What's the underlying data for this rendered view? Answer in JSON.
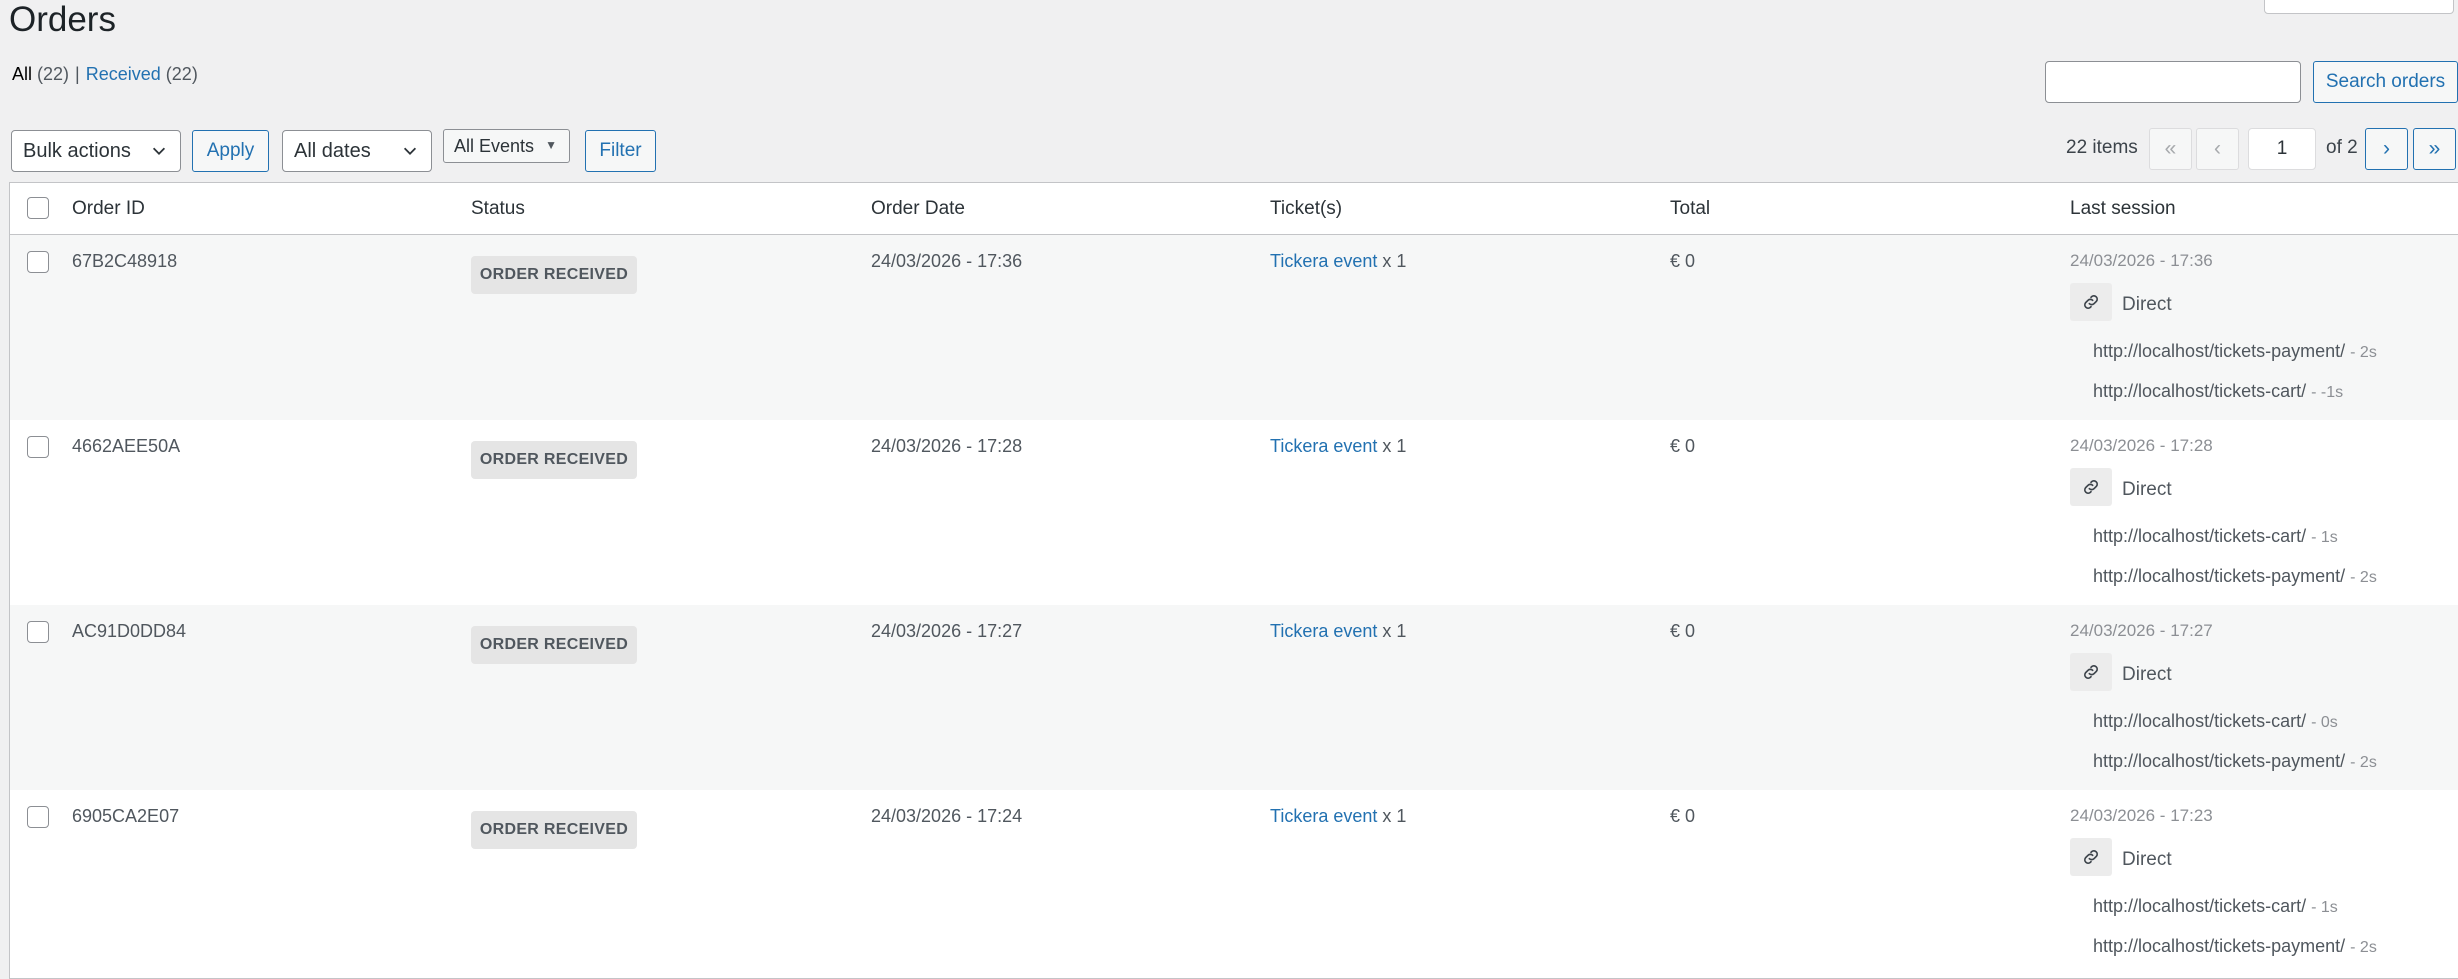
{
  "page": {
    "title": "Orders"
  },
  "views": {
    "all_label": "All",
    "all_count": "(22)",
    "separator": "|",
    "received_label": "Received",
    "received_count": "(22)"
  },
  "search": {
    "value": "",
    "button_label": "Search orders"
  },
  "filters": {
    "bulk_actions": "Bulk actions",
    "apply_label": "Apply",
    "dates": "All dates",
    "events": "All Events",
    "filter_label": "Filter"
  },
  "pagination": {
    "items": "22 items",
    "first": "«",
    "prev": "‹",
    "next": "›",
    "last": "»",
    "current_page": "1",
    "of_label": "of 2"
  },
  "table": {
    "columns": {
      "order_id": "Order ID",
      "status": "Status",
      "order_date": "Order Date",
      "tickets": "Ticket(s)",
      "total": "Total",
      "last_session": "Last session"
    },
    "rows": [
      {
        "order_id": "67B2C48918",
        "status": "ORDER RECEIVED",
        "order_date": "24/03/2026 - 17:36",
        "ticket_name": "Tickera event",
        "ticket_qty": "x 1",
        "total": "€ 0",
        "session_date": "24/03/2026 - 17:36",
        "session_source": "Direct",
        "session_icon": "link-icon",
        "urls": [
          {
            "url": "http://localhost/tickets-payment/",
            "duration": "- 2s"
          },
          {
            "url": "http://localhost/tickets-cart/",
            "duration": "- -1s"
          }
        ]
      },
      {
        "order_id": "4662AEE50A",
        "status": "ORDER RECEIVED",
        "order_date": "24/03/2026 - 17:28",
        "ticket_name": "Tickera event",
        "ticket_qty": "x 1",
        "total": "€ 0",
        "session_date": "24/03/2026 - 17:28",
        "session_source": "Direct",
        "session_icon": "link-icon",
        "urls": [
          {
            "url": "http://localhost/tickets-cart/",
            "duration": "- 1s"
          },
          {
            "url": "http://localhost/tickets-payment/",
            "duration": "- 2s"
          }
        ]
      },
      {
        "order_id": "AC91D0DD84",
        "status": "ORDER RECEIVED",
        "order_date": "24/03/2026 - 17:27",
        "ticket_name": "Tickera event",
        "ticket_qty": "x 1",
        "total": "€ 0",
        "session_date": "24/03/2026 - 17:27",
        "session_source": "Direct",
        "session_icon": "link-icon",
        "urls": [
          {
            "url": "http://localhost/tickets-cart/",
            "duration": "- 0s"
          },
          {
            "url": "http://localhost/tickets-payment/",
            "duration": "- 2s"
          }
        ]
      },
      {
        "order_id": "6905CA2E07",
        "status": "ORDER RECEIVED",
        "order_date": "24/03/2026 - 17:24",
        "ticket_name": "Tickera event",
        "ticket_qty": "x 1",
        "total": "€ 0",
        "session_date": "24/03/2026 - 17:23",
        "session_source": "Direct",
        "session_icon": "link-icon",
        "urls": [
          {
            "url": "http://localhost/tickets-cart/",
            "duration": "- 1s"
          },
          {
            "url": "http://localhost/tickets-payment/",
            "duration": "- 2s"
          }
        ]
      }
    ]
  }
}
